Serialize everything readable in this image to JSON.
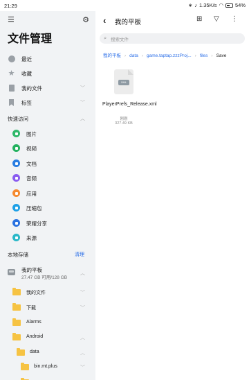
{
  "status": {
    "time": "21:29",
    "bluetooth_icon": "bluetooth-icon",
    "mute_icon": "mute-icon",
    "net_speed": "1.35K/s",
    "wifi_icon": "wifi-icon",
    "battery": "54%"
  },
  "sidebar": {
    "title": "文件管理",
    "top_items": [
      {
        "label": "最近",
        "icon": "clock-icon"
      },
      {
        "label": "收藏",
        "icon": "star-icon"
      },
      {
        "label": "我的文件",
        "icon": "document-icon"
      },
      {
        "label": "标签",
        "icon": "bookmark-icon"
      }
    ],
    "quick_access_title": "快速访问",
    "quick_access": [
      {
        "label": "图片",
        "color": "#2fb86a"
      },
      {
        "label": "视频",
        "color": "#24b15f"
      },
      {
        "label": "文档",
        "color": "#2a7de1"
      },
      {
        "label": "音频",
        "color": "#8a5cf0"
      },
      {
        "label": "应用",
        "color": "#f58a30"
      },
      {
        "label": "压缩包",
        "color": "#1ea0e6"
      },
      {
        "label": "荣耀分享",
        "color": "#2a72e0"
      },
      {
        "label": "来源",
        "color": "#2ab8c8"
      }
    ],
    "storage_title": "本地存储",
    "clear_label": "清理",
    "device": {
      "name": "我的平板",
      "capacity": "27.47 GB 可用/128 GB"
    },
    "tree": [
      {
        "label": "我的文件",
        "level": 1
      },
      {
        "label": "下载",
        "level": 1
      },
      {
        "label": "Alarms",
        "level": 1
      },
      {
        "label": "Android",
        "level": 1
      },
      {
        "label": "data",
        "level": 2
      },
      {
        "label": "bin.mt.plus",
        "level": 3
      }
    ]
  },
  "main": {
    "title": "我的平板",
    "search_placeholder": "搜索文件",
    "breadcrumb": [
      "我的平板",
      "data",
      "game.taptap.zzzProj...",
      "files",
      "Save"
    ],
    "file": {
      "name": "PlayerPrefs_Release.xml",
      "badge": "XML",
      "time": "刚刚",
      "size": "327.49 KB"
    }
  }
}
